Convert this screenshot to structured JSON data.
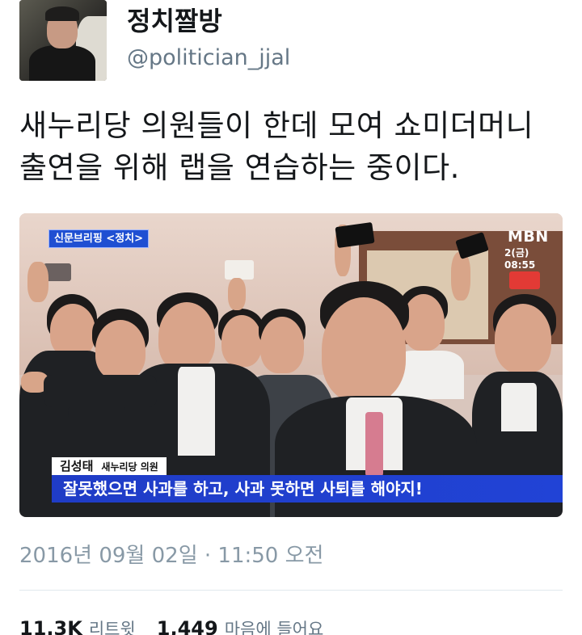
{
  "user": {
    "display_name": "정치짤방",
    "handle": "@politician_jjal"
  },
  "tweet": {
    "text_line1": "새누리당 의원들이 한데 모여 쇼미더머니",
    "text_line2": "출연을 위해 랩을 연습하는 중이다.",
    "timestamp": "2016년 09월 02일 · 11:50 오전"
  },
  "media": {
    "program_label": "신문브리핑 <정치>",
    "channel_logo": "MBN",
    "broadcast_time": "2(금) 08:55",
    "speaker_name": "김성태",
    "speaker_role": "새누리당 의원",
    "caption": "잘못했으면 사과를 하고, 사과 못하면 사퇴를 해야지!"
  },
  "stats": {
    "retweets": "11.3K",
    "retweets_label": "리트윗",
    "likes": "1,449",
    "likes_label": "마음에 들어요"
  },
  "colors": {
    "text_primary": "#14171a",
    "text_secondary": "#657786",
    "caption_blue": "#2143d6"
  }
}
